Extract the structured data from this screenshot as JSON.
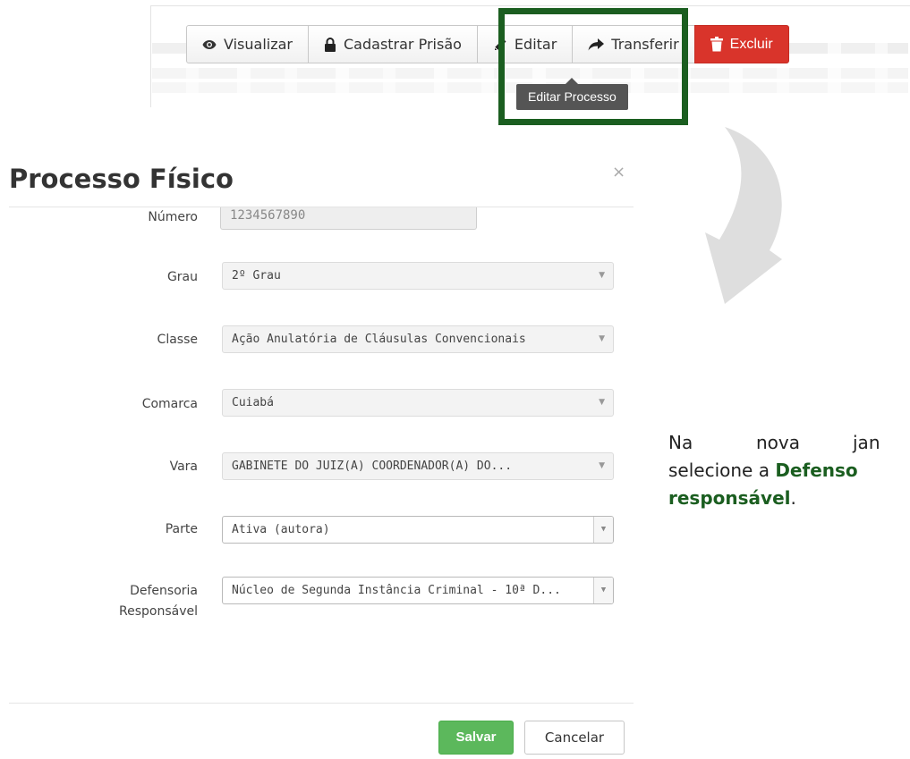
{
  "toolbar": {
    "buttons": [
      {
        "label": "Visualizar",
        "icon": "eye-icon"
      },
      {
        "label": "Cadastrar Prisão",
        "icon": "lock-icon"
      },
      {
        "label": "Editar",
        "icon": "pencil-icon"
      },
      {
        "label": "Transferir",
        "icon": "share-arrow-icon"
      },
      {
        "label": "Excluir",
        "icon": "trash-icon"
      }
    ],
    "tooltip": "Editar Processo"
  },
  "colors": {
    "highlight": "#1b5e20",
    "danger": "#d9342b",
    "success": "#5cb85c",
    "emphasis_text": "#1b5e20"
  },
  "modal": {
    "title": "Processo Físico",
    "close": "×",
    "fields": {
      "numero": {
        "label": "Número",
        "value": "1234567890"
      },
      "grau": {
        "label": "Grau",
        "value": "2º Grau"
      },
      "classe": {
        "label": "Classe",
        "value": "Ação Anulatória de Cláusulas Convencionais"
      },
      "comarca": {
        "label": "Comarca",
        "value": "Cuiabá"
      },
      "vara": {
        "label": "Vara",
        "value": "GABINETE DO JUIZ(A) COORDENADOR(A) DO..."
      },
      "parte": {
        "label": "Parte",
        "value": "Ativa (autora)"
      },
      "defensoria": {
        "label_line1": "Defensoria",
        "label_line2": "Responsável",
        "value": "Núcleo de Segunda Instância Criminal - 10ª D..."
      }
    },
    "buttons": {
      "save": "Salvar",
      "cancel": "Cancelar"
    }
  },
  "side_text": {
    "word1": "Na",
    "word2": "nova",
    "word3": "jan",
    "line2_prefix": "selecione a ",
    "line2_bold": "Defenso",
    "line3_bold": "responsável",
    "line3_suffix": "."
  }
}
